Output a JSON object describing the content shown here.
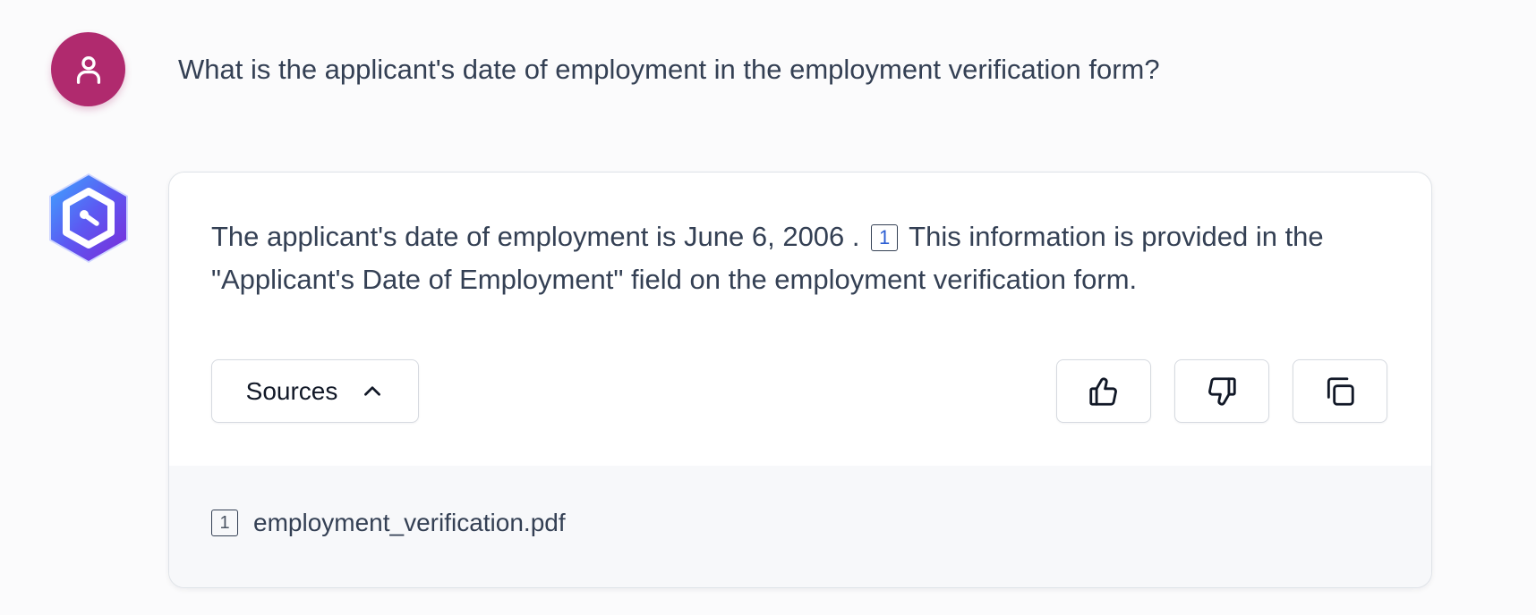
{
  "conversation": {
    "user": {
      "avatar_icon": "user-icon",
      "avatar_color": "#b02a6e",
      "question": "What is the applicant's date of employment in the employment verification form?"
    },
    "assistant": {
      "avatar_icon": "hexagon-logo-icon",
      "answer": {
        "text_before_citation": "The applicant's date of employment is June 6, 2006 .",
        "citation": "1",
        "text_after_citation": "This information is provided in the \"Applicant's Date of Employment\" field on the employment verification form."
      },
      "actions": {
        "sources_label": "Sources",
        "sources_icon": "chevron-up-icon",
        "like_icon": "thumbs-up-icon",
        "dislike_icon": "thumbs-down-icon",
        "copy_icon": "copy-icon"
      },
      "sources": [
        {
          "number": "1",
          "name": "employment_verification.pdf"
        }
      ]
    }
  }
}
